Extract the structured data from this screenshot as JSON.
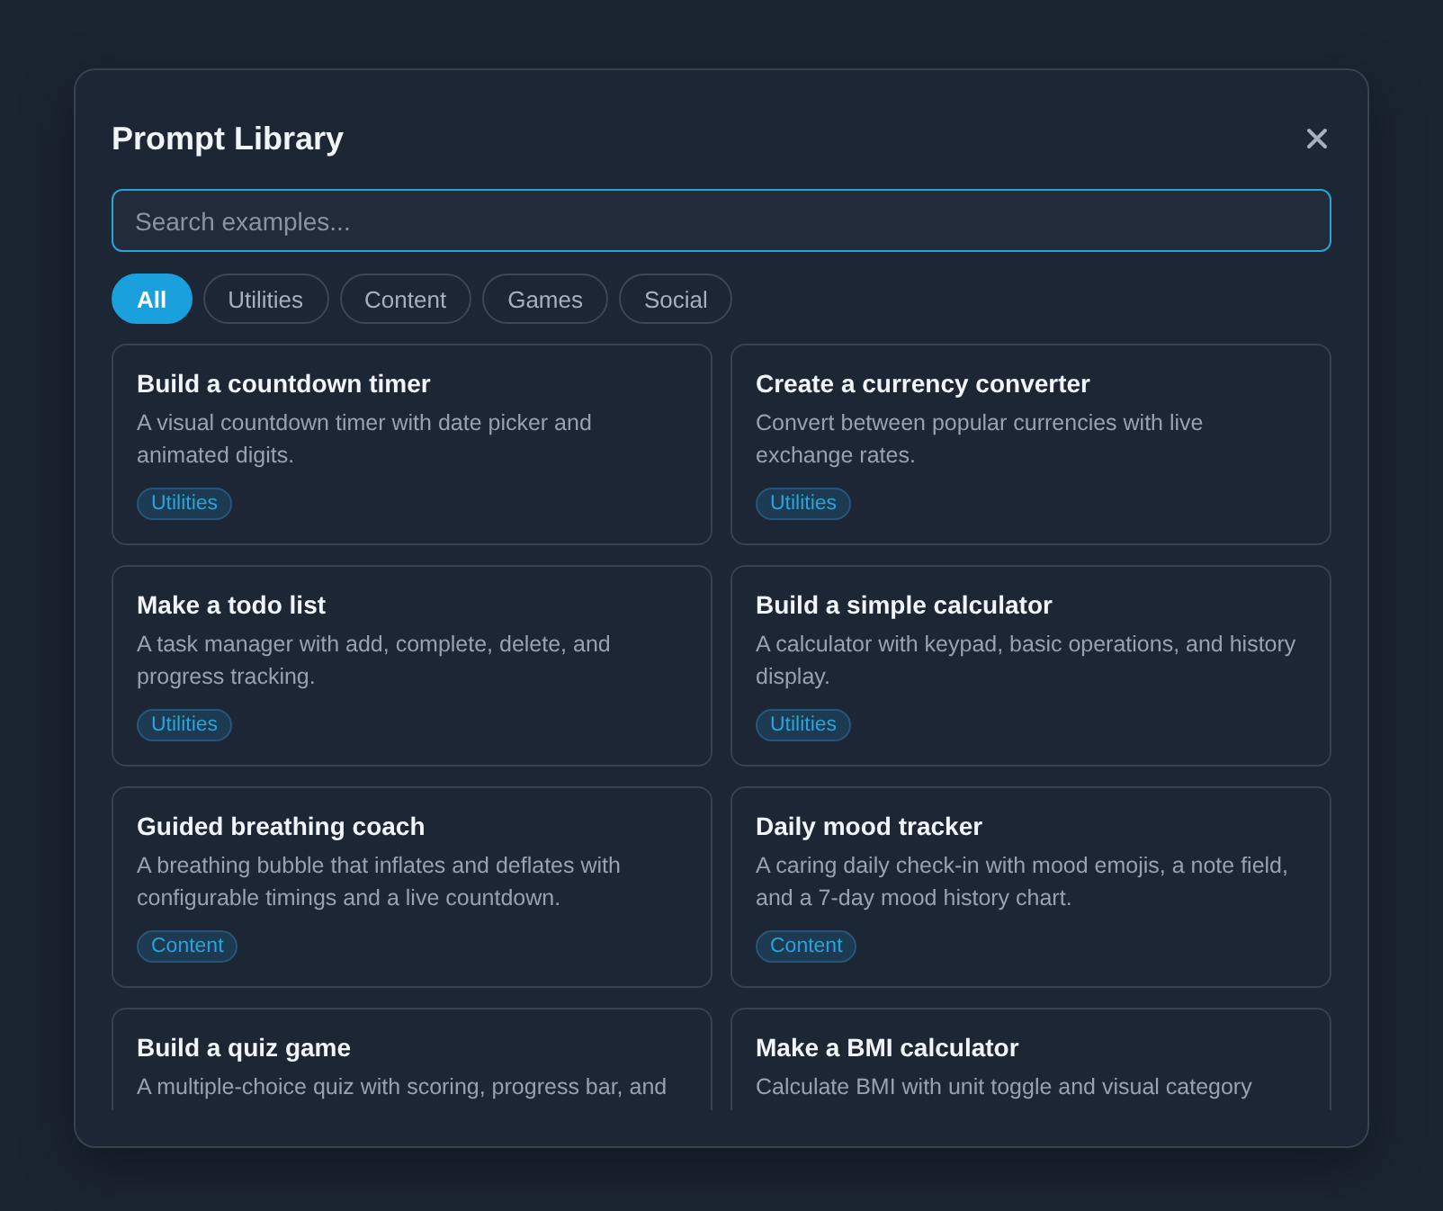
{
  "dialog": {
    "title": "Prompt Library",
    "search": {
      "placeholder": "Search examples..."
    },
    "filters": [
      {
        "label": "All",
        "selected": true
      },
      {
        "label": "Utilities",
        "selected": false
      },
      {
        "label": "Content",
        "selected": false
      },
      {
        "label": "Games",
        "selected": false
      },
      {
        "label": "Social",
        "selected": false
      }
    ],
    "cards": [
      {
        "title": "Build a countdown timer",
        "description": "A visual countdown timer with date picker and animated digits.",
        "tag": "Utilities"
      },
      {
        "title": "Create a currency converter",
        "description": "Convert between popular currencies with live exchange rates.",
        "tag": "Utilities"
      },
      {
        "title": "Make a todo list",
        "description": "A task manager with add, complete, delete, and progress tracking.",
        "tag": "Utilities"
      },
      {
        "title": "Build a simple calculator",
        "description": "A calculator with keypad, basic operations, and history display.",
        "tag": "Utilities"
      },
      {
        "title": "Guided breathing coach",
        "description": "A breathing bubble that inflates and deflates with configurable timings and a live countdown.",
        "tag": "Content"
      },
      {
        "title": "Daily mood tracker",
        "description": "A caring daily check-in with mood emojis, a note field, and a 7-day mood history chart.",
        "tag": "Content"
      },
      {
        "title": "Build a quiz game",
        "description": "A multiple-choice quiz with scoring, progress bar, and"
      },
      {
        "title": "Make a BMI calculator",
        "description": "Calculate BMI with unit toggle and visual category"
      }
    ]
  }
}
